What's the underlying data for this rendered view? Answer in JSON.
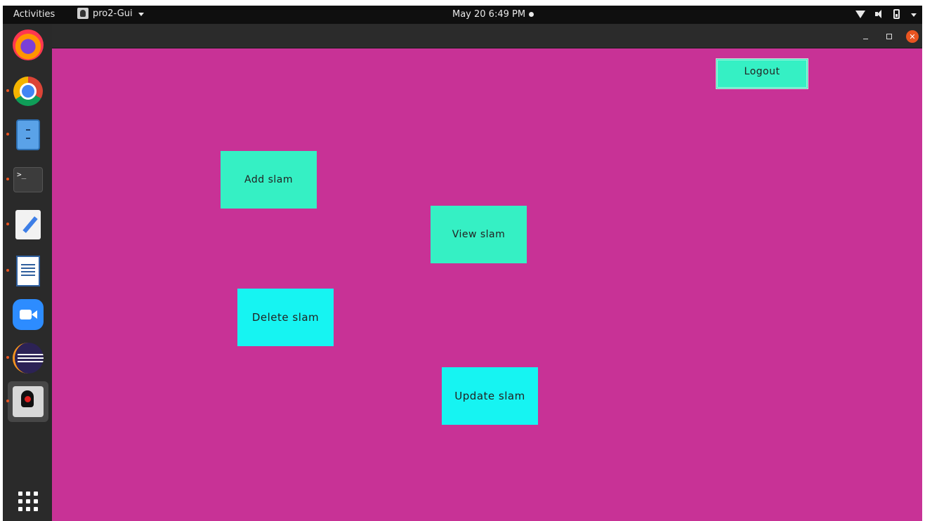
{
  "topbar": {
    "activities": "Activities",
    "app_name": "pro2-Gui",
    "clock": "May 20  6:49 PM"
  },
  "dock": {
    "items": [
      "firefox-icon",
      "chrome-icon",
      "files-icon",
      "terminal-icon",
      "text-editor-icon",
      "libreoffice-writer-icon",
      "zoom-icon",
      "eclipse-icon",
      "java-duke-icon",
      "show-apps-icon"
    ],
    "terminal_glyph": ">_"
  },
  "window": {
    "close_glyph": "✕"
  },
  "app": {
    "background_color": "#c83296",
    "buttons": {
      "logout": "Logout",
      "add": "Add slam",
      "view": "View slam",
      "delete": "Delete slam",
      "update": "Update slam"
    }
  }
}
